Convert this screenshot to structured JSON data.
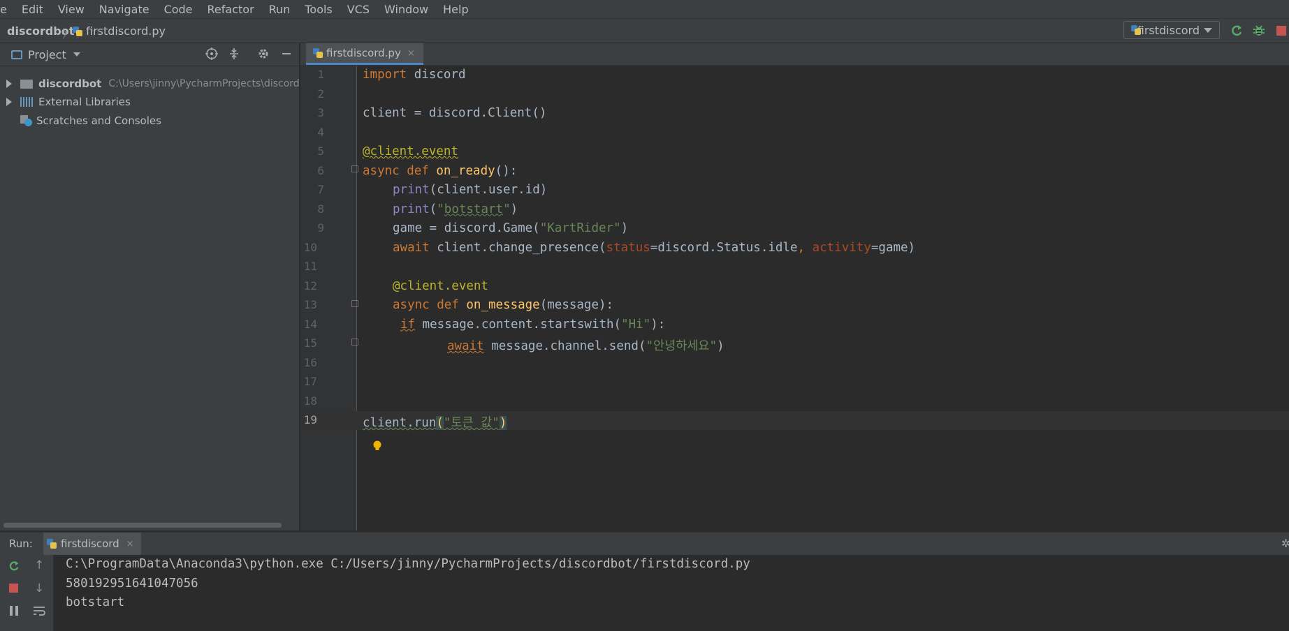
{
  "menubar": {
    "items": [
      "e",
      "Edit",
      "View",
      "Navigate",
      "Code",
      "Refactor",
      "Run",
      "Tools",
      "VCS",
      "Window",
      "Help"
    ]
  },
  "navbar": {
    "project": "discordbot",
    "separator": "〉",
    "file": "firstdiscord.py",
    "run_config": "firstdiscord"
  },
  "project_panel": {
    "title": "Project",
    "items": [
      {
        "label": "discordbot",
        "path": "C:\\Users\\jinny\\PycharmProjects\\discord"
      },
      {
        "label": "External Libraries"
      },
      {
        "label": "Scratches and Consoles"
      }
    ]
  },
  "editor": {
    "tab_label": "firstdiscord.py",
    "close_glyph": "×",
    "line_numbers": [
      "1",
      "2",
      "3",
      "4",
      "5",
      "6",
      "7",
      "8",
      "9",
      "10",
      "11",
      "12",
      "13",
      "14",
      "15",
      "16",
      "17",
      "18",
      "19"
    ],
    "code": {
      "l1_kw": "import",
      "l1_rest": " discord",
      "l3": "client = discord.Client()",
      "l5": "@client.event",
      "l6_kw": "async def ",
      "l6_fn": "on_ready",
      "l6_rest": "():",
      "l7_bi": "print",
      "l7_rest": "(client.user.id)",
      "l8_bi": "print",
      "l8_open": "(",
      "l8_q1": "\"",
      "l8_str": "botstart",
      "l8_q2": "\"",
      "l8_close": ")",
      "l9_a": "game = discord.Game(",
      "l9_str": "\"KartRider\"",
      "l9_b": ")",
      "l10_kw": "await",
      "l10_a": " client.change_presence(",
      "l10_p1": "status",
      "l10_b": "=discord.Status.idle",
      "l10_comma": ", ",
      "l10_p2": "activity",
      "l10_c": "=game)",
      "l12": "@client.event",
      "l13_kw": "async def ",
      "l13_fn": "on_message",
      "l13_rest": "(message):",
      "l14_kw": "if",
      "l14_a": " message.content.startswith(",
      "l14_str": "\"Hi\"",
      "l14_b": "):",
      "l15_kw": "await",
      "l15_a": " message.channel.send(",
      "l15_str": "\"안녕하세요\"",
      "l15_b": ")",
      "l19_a": "client.run",
      "l19_open": "(",
      "l19_str": "\"토큰 값\"",
      "l19_close": ")"
    }
  },
  "run_panel": {
    "label": "Run:",
    "tab_label": "firstdiscord",
    "close_glyph": "×",
    "output": [
      "C:\\ProgramData\\Anaconda3\\python.exe C:/Users/jinny/PycharmProjects/discordbot/firstdiscord.py",
      "580192951641047056",
      "botstart"
    ]
  },
  "colors": {
    "keyword": "#cc7832",
    "function": "#ffc66d",
    "string": "#6a8759",
    "decorator": "#bbb529",
    "builtin": "#8888c6",
    "param": "#aa4926",
    "background": "#2b2b2b"
  },
  "icons": {
    "locate": "crosshair-icon",
    "collapse": "collapse-icon",
    "settings": "gear-icon",
    "hide": "minimize-icon",
    "rerun": "rerun-icon",
    "debug": "bug-icon",
    "stop": "stop-icon",
    "bulb": "lightbulb-icon"
  }
}
